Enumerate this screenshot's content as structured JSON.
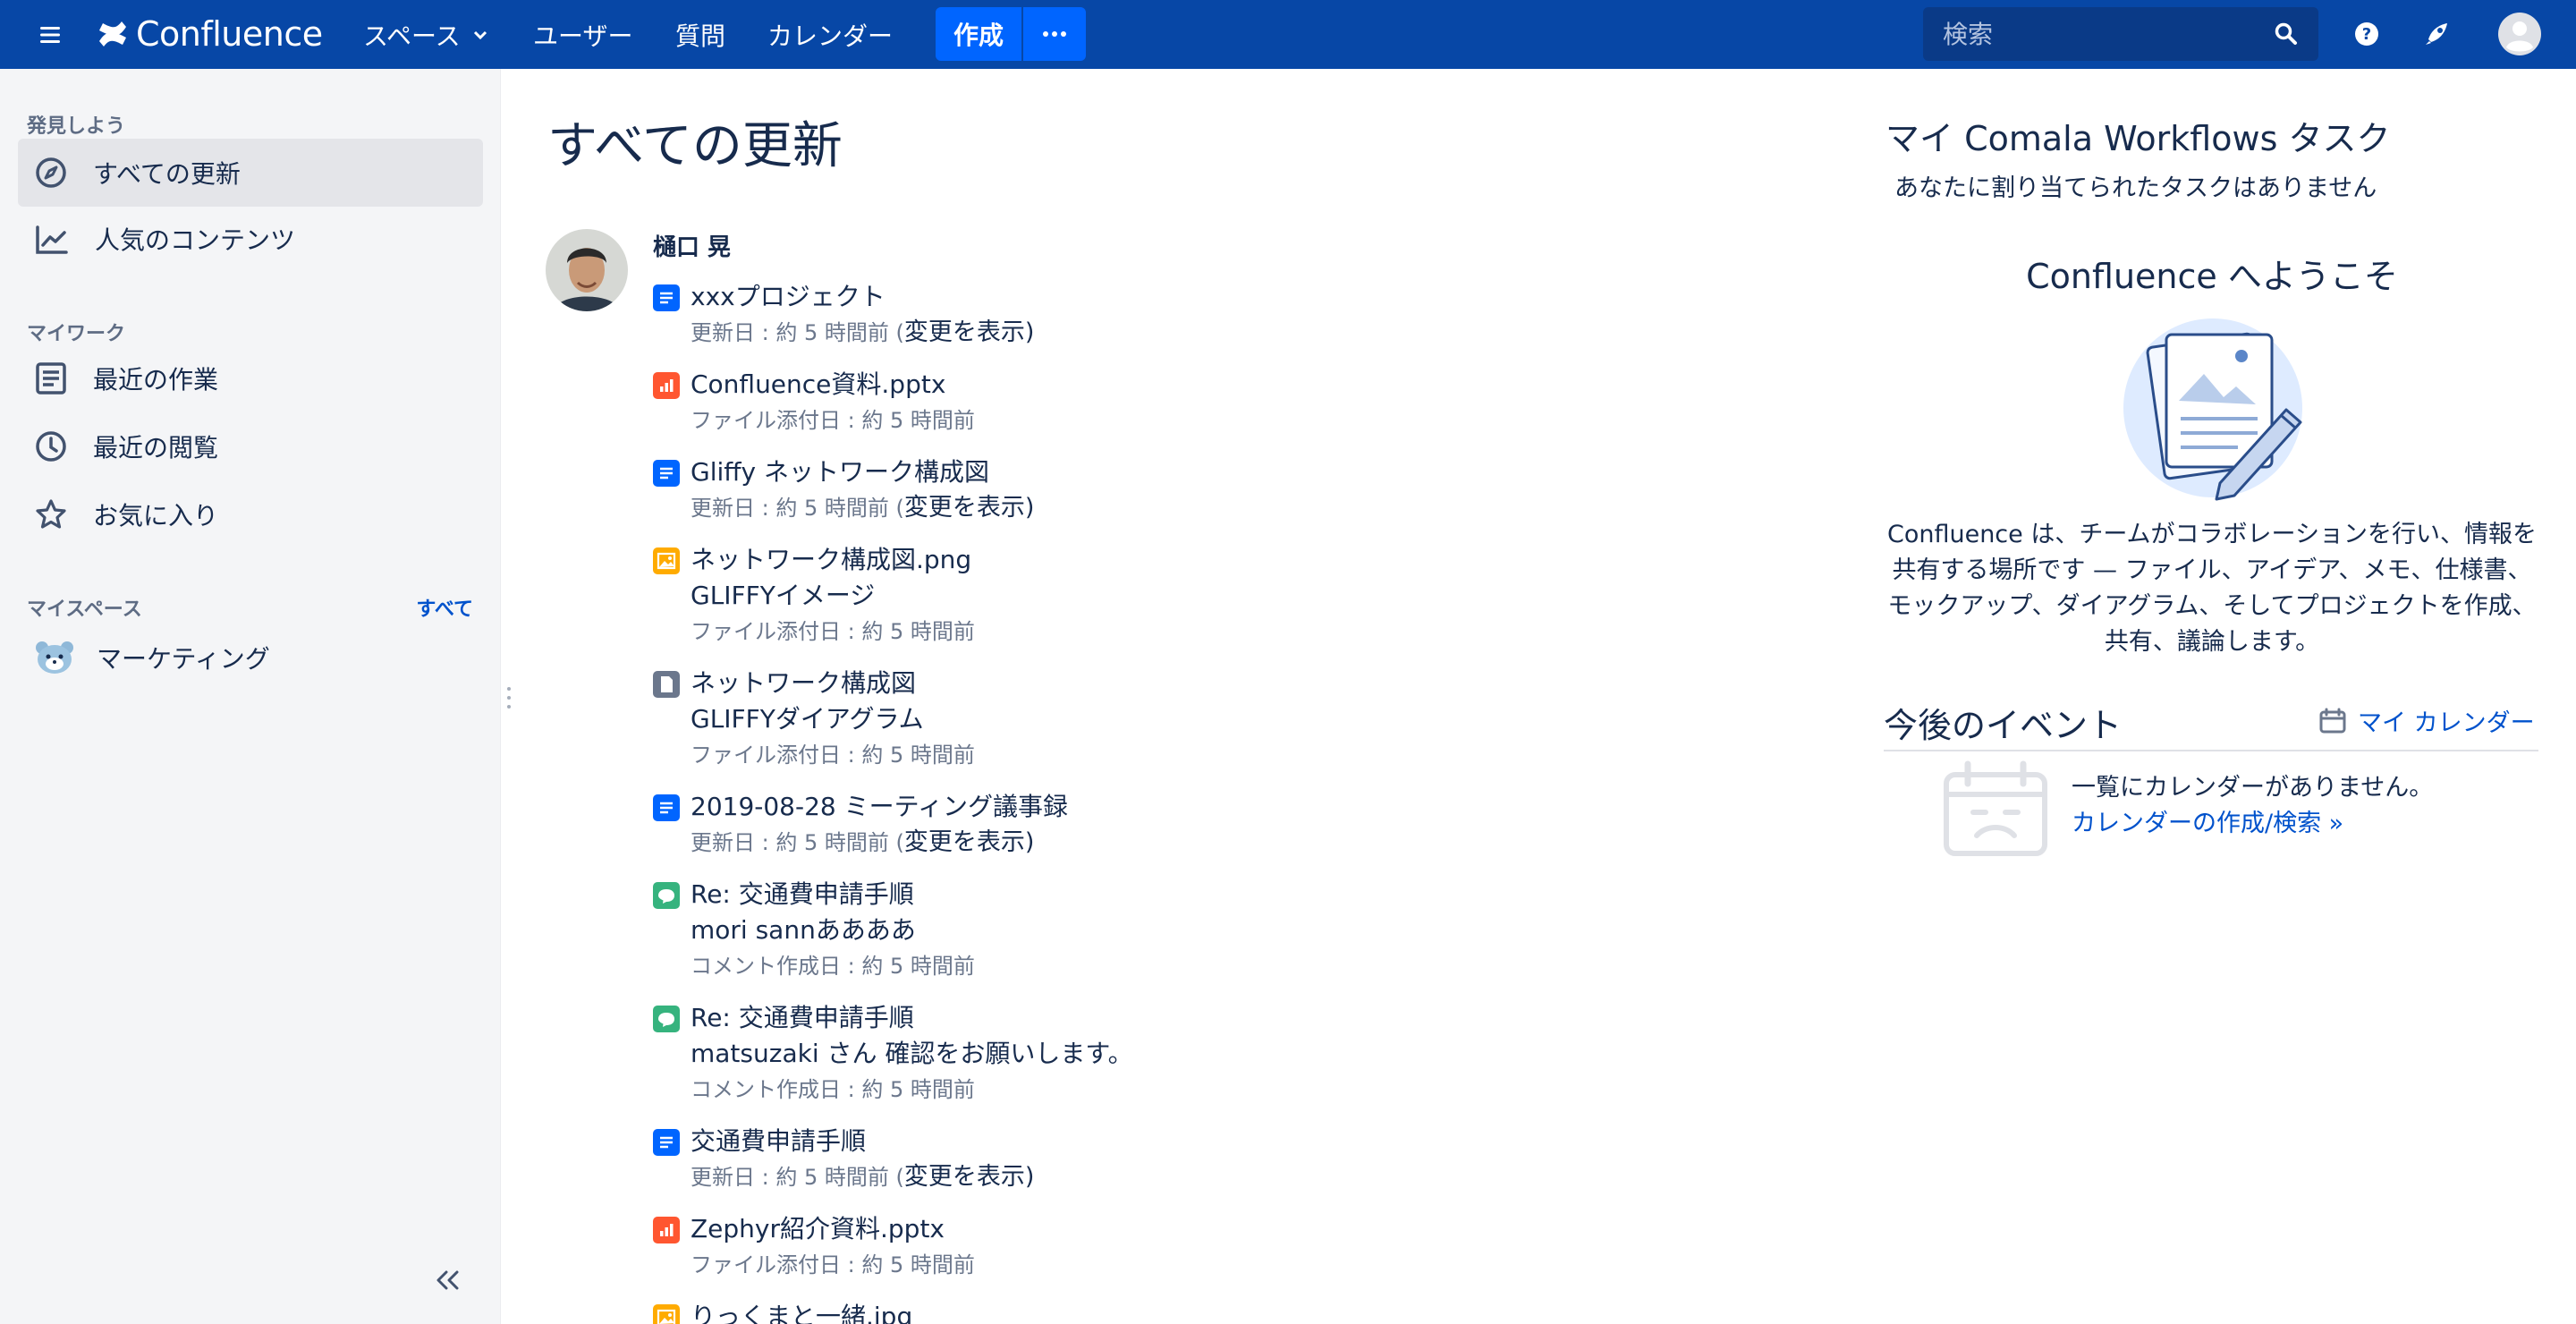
{
  "header": {
    "brand": "Confluence",
    "nav": [
      {
        "label": "スペース",
        "dropdown": true
      },
      {
        "label": "ユーザー"
      },
      {
        "label": "質問"
      },
      {
        "label": "カレンダー"
      }
    ],
    "create_label": "作成",
    "search_placeholder": "検索",
    "colors": {
      "bar": "#0747a6",
      "create": "#0065ff"
    }
  },
  "sidebar": {
    "discover_heading": "発見しよう",
    "discover_items": [
      {
        "label": "すべての更新",
        "icon": "compass-icon",
        "active": true
      },
      {
        "label": "人気のコンテンツ",
        "icon": "trending-icon",
        "active": false
      }
    ],
    "mywork_heading": "マイワーク",
    "mywork_items": [
      {
        "label": "最近の作業",
        "icon": "document-icon"
      },
      {
        "label": "最近の閲覧",
        "icon": "clock-icon"
      },
      {
        "label": "お気に入り",
        "icon": "star-icon"
      }
    ],
    "myspaces_heading": "マイスペース",
    "myspaces_all_label": "すべて",
    "spaces": [
      {
        "label": "マーケティング",
        "icon": "space-avatar-icon"
      }
    ]
  },
  "main": {
    "title": "すべての更新",
    "author": "樋口 晃",
    "entries": [
      {
        "type": "page",
        "title": "xxxプロジェクト",
        "meta": "更新日 : 約 5 時間前 (",
        "link": "変更を表示",
        "tail": ")"
      },
      {
        "type": "pptx",
        "title": "Confluence資料.pptx",
        "meta": "ファイル添付日 : 約 5 時間前"
      },
      {
        "type": "page",
        "title": "Gliffy ネットワーク構成図",
        "meta": "更新日 : 約 5 時間前 (",
        "link": "変更を表示",
        "tail": ")"
      },
      {
        "type": "image",
        "title": "ネットワーク構成図.png",
        "sub": "GLIFFYイメージ",
        "meta": "ファイル添付日 : 約 5 時間前"
      },
      {
        "type": "file",
        "title": "ネットワーク構成図",
        "sub": "GLIFFYダイアグラム",
        "meta": "ファイル添付日 : 約 5 時間前"
      },
      {
        "type": "page",
        "title": "2019-08-28 ミーティング議事録",
        "meta": "更新日 : 約 5 時間前 (",
        "link": "変更を表示",
        "tail": ")"
      },
      {
        "type": "comment",
        "title": "Re: 交通費申請手順",
        "sub": "mori sannああああ",
        "meta": "コメント作成日 : 約 5 時間前"
      },
      {
        "type": "comment",
        "title": "Re: 交通費申請手順",
        "sub": "matsuzaki さん 確認をお願いします。",
        "meta": "コメント作成日 : 約 5 時間前"
      },
      {
        "type": "page",
        "title": "交通費申請手順",
        "meta": "更新日 : 約 5 時間前 (",
        "link": "変更を表示",
        "tail": ")"
      },
      {
        "type": "pptx",
        "title": "Zephyr紹介資料.pptx",
        "meta": "ファイル添付日 : 約 5 時間前"
      },
      {
        "type": "image",
        "title": "りっくまと一緒.jpg",
        "meta": ""
      }
    ],
    "icon_colors": {
      "page": "#0065ff",
      "pptx": "#ff5630",
      "image": "#ffab00",
      "file": "#6b778c",
      "comment": "#36b37e"
    }
  },
  "right_panel": {
    "tasks_title": "マイ Comala Workflows タスク",
    "tasks_empty": "あなたに割り当てられたタスクはありません",
    "welcome_title": "Confluence へようこそ",
    "welcome_text": "Confluence は、チームがコラボレーションを行い、情報を共有する場所です — ファイル、アイデア、メモ、仕様書、モックアップ、ダイアグラム、そしてプロジェクトを作成、共有、議論します。",
    "events_title": "今後のイベント",
    "my_calendar_link": "マイ カレンダー",
    "no_calendar_text": "一覧にカレンダーがありません。",
    "find_calendar_link": "カレンダーの作成/検索 »"
  }
}
